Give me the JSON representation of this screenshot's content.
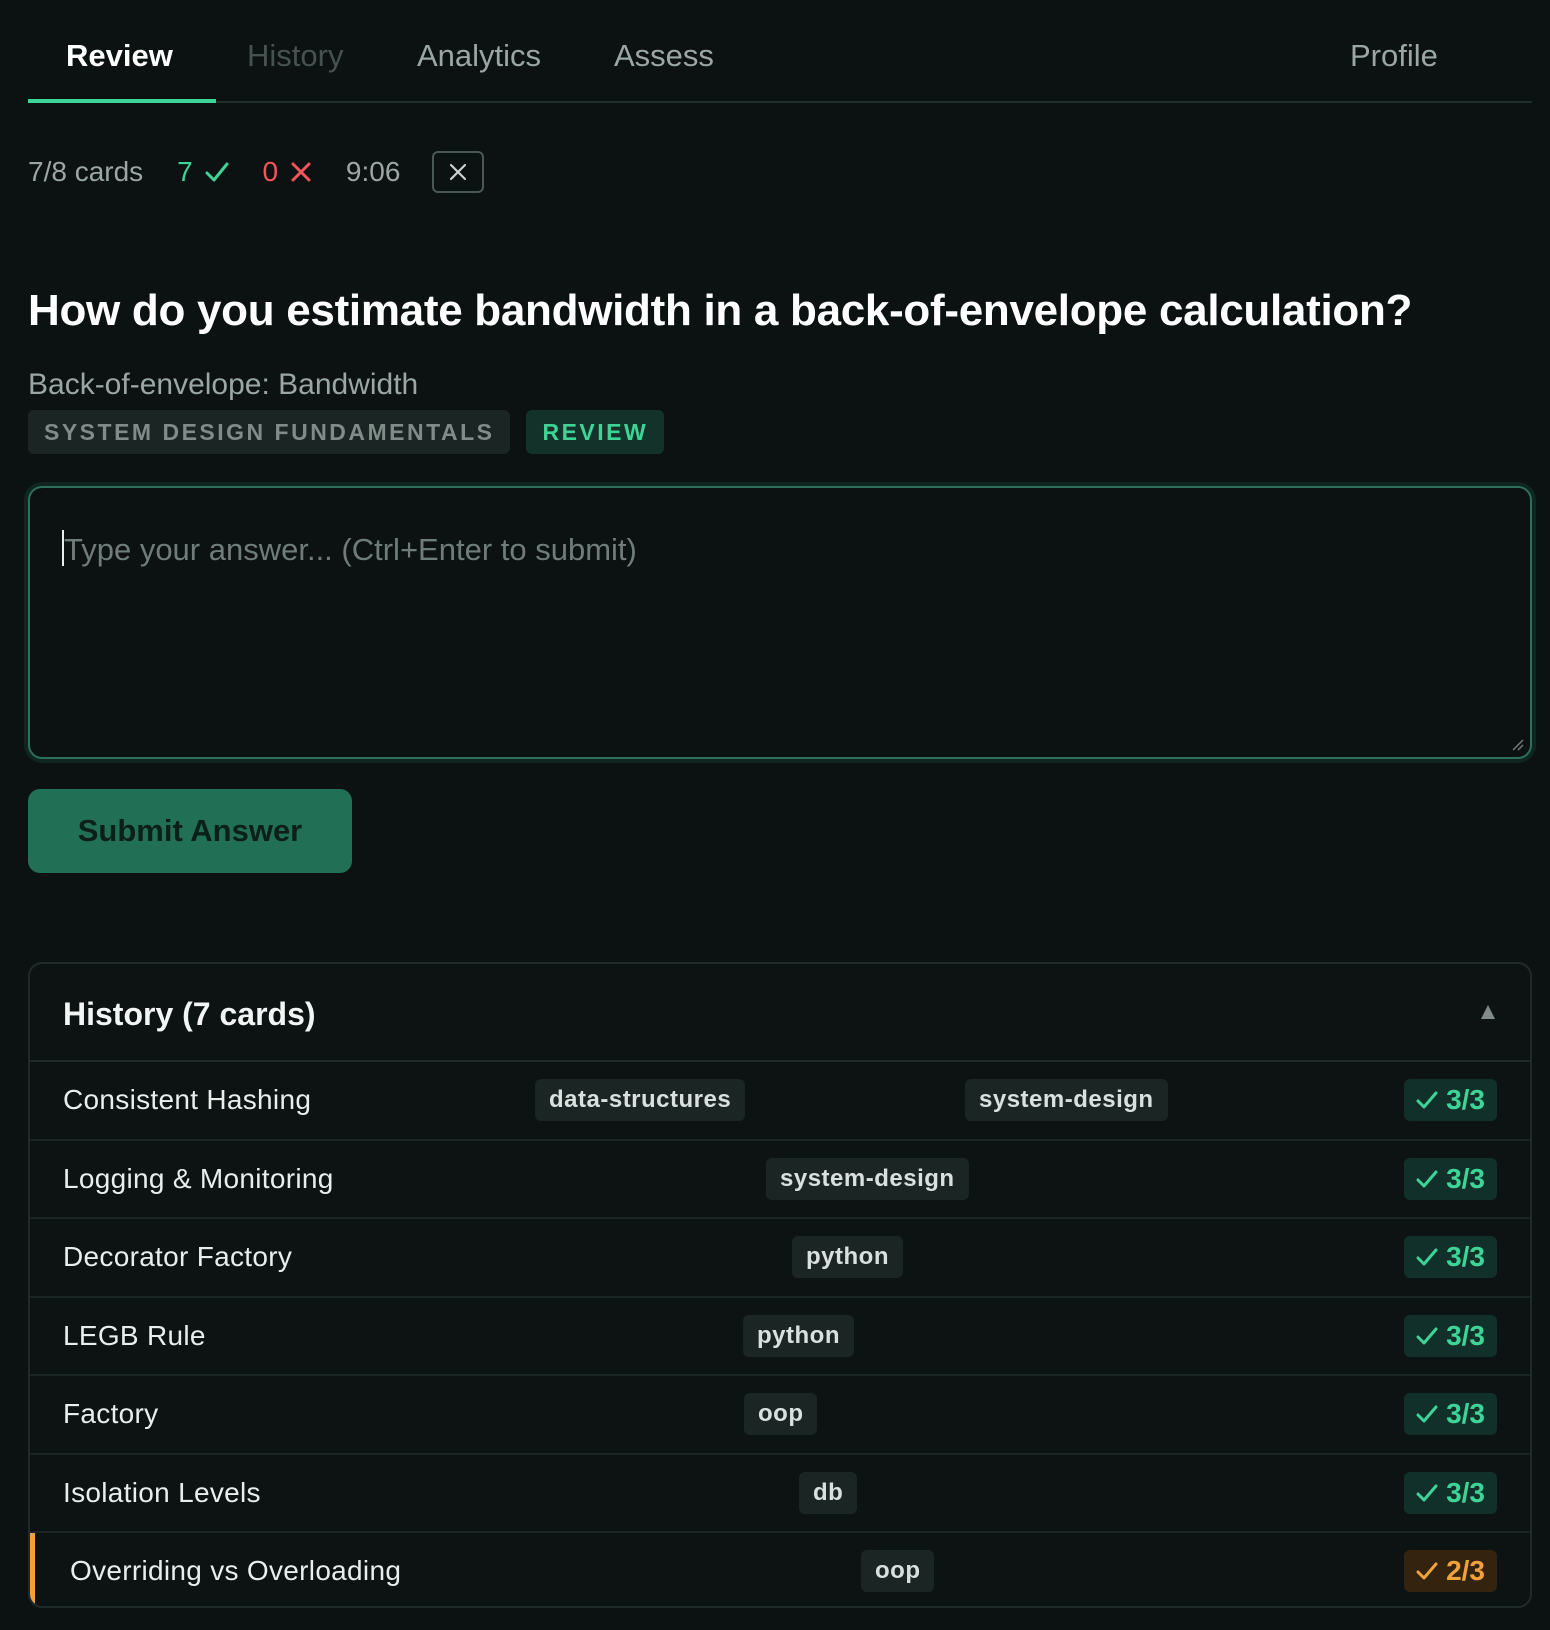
{
  "tabs": [
    {
      "label": "Review"
    },
    {
      "label": "History"
    },
    {
      "label": "Analytics"
    },
    {
      "label": "Assess"
    },
    {
      "label": "Profile"
    }
  ],
  "stats": {
    "cards": "7/8 cards",
    "correct": "7",
    "wrong": "0",
    "timer": "9:06"
  },
  "card": {
    "question": "How do you estimate bandwidth in a back-of-envelope calculation?",
    "subtitle": "Back-of-envelope: Bandwidth",
    "topic_badge": "SYSTEM DESIGN FUNDAMENTALS",
    "mode_badge": "REVIEW"
  },
  "answer": {
    "placeholder": "Type your answer... (Ctrl+Enter to submit)",
    "value": ""
  },
  "submit_label": "Submit Answer",
  "history": {
    "title": "History (7 cards)",
    "rows": [
      {
        "title": "Consistent Hashing",
        "tags": [
          "data-structures",
          "system-design"
        ],
        "score": "3/3",
        "status": "ok"
      },
      {
        "title": "Logging & Monitoring",
        "tags": [
          "system-design"
        ],
        "score": "3/3",
        "status": "ok"
      },
      {
        "title": "Decorator Factory",
        "tags": [
          "python"
        ],
        "score": "3/3",
        "status": "ok"
      },
      {
        "title": "LEGB Rule",
        "tags": [
          "python"
        ],
        "score": "3/3",
        "status": "ok"
      },
      {
        "title": "Factory",
        "tags": [
          "oop"
        ],
        "score": "3/3",
        "status": "ok"
      },
      {
        "title": "Isolation Levels",
        "tags": [
          "db"
        ],
        "score": "3/3",
        "status": "ok"
      },
      {
        "title": "Overriding vs Overloading",
        "tags": [
          "oop"
        ],
        "score": "2/3",
        "status": "partial"
      }
    ]
  },
  "colors": {
    "accent": "#3fd497",
    "error": "#f2555a",
    "warning": "#f0a33a",
    "background": "#0b1211"
  },
  "icons": {
    "correct": "check-icon",
    "wrong": "x-icon",
    "close": "close-icon",
    "collapse": "triangle-up-icon"
  }
}
